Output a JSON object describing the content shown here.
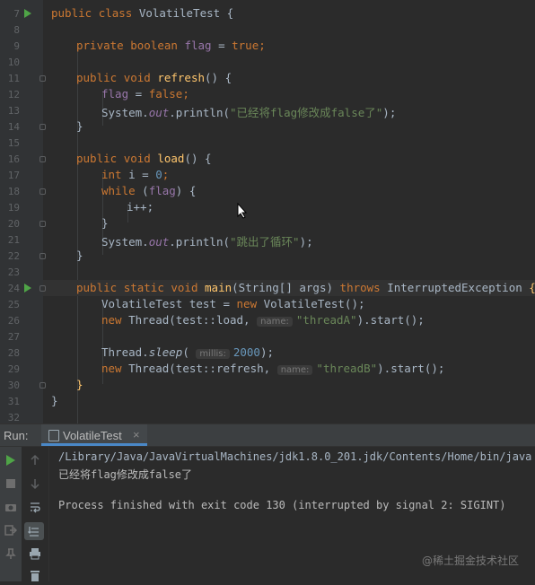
{
  "editor": {
    "lines": [
      {
        "num": "7",
        "tokens": [
          {
            "t": "public ",
            "c": "kw"
          },
          {
            "t": "class ",
            "c": "kw"
          },
          {
            "t": "VolatileTest {",
            "c": ""
          }
        ],
        "run": true,
        "indent": 0
      },
      {
        "num": "8",
        "tokens": [],
        "indent": 0
      },
      {
        "num": "9",
        "tokens": [
          {
            "t": "private ",
            "c": "kw"
          },
          {
            "t": "boolean ",
            "c": "kw"
          },
          {
            "t": "flag",
            "c": "fld"
          },
          {
            "t": " = ",
            "c": ""
          },
          {
            "t": "true",
            "c": "kw"
          },
          {
            "t": ";",
            "c": "kw"
          }
        ],
        "indent": 1
      },
      {
        "num": "10",
        "tokens": [],
        "indent": 0
      },
      {
        "num": "11",
        "tokens": [
          {
            "t": "public ",
            "c": "kw"
          },
          {
            "t": "void ",
            "c": "kw"
          },
          {
            "t": "refresh",
            "c": "fn"
          },
          {
            "t": "() {",
            "c": ""
          }
        ],
        "indent": 1,
        "fold": true
      },
      {
        "num": "12",
        "tokens": [
          {
            "t": "flag",
            "c": "fld"
          },
          {
            "t": " = ",
            "c": ""
          },
          {
            "t": "false",
            "c": "kw"
          },
          {
            "t": ";",
            "c": "kw"
          }
        ],
        "indent": 2
      },
      {
        "num": "13",
        "tokens": [
          {
            "t": "System.",
            "c": ""
          },
          {
            "t": "out",
            "c": "fld ital"
          },
          {
            "t": ".println(",
            "c": ""
          },
          {
            "t": "\"已经将flag修改成false了\"",
            "c": "str"
          },
          {
            "t": ");",
            "c": ""
          }
        ],
        "indent": 2
      },
      {
        "num": "14",
        "tokens": [
          {
            "t": "}",
            "c": ""
          }
        ],
        "indent": 1,
        "fold": true
      },
      {
        "num": "15",
        "tokens": [],
        "indent": 0
      },
      {
        "num": "16",
        "tokens": [
          {
            "t": "public ",
            "c": "kw"
          },
          {
            "t": "void ",
            "c": "kw"
          },
          {
            "t": "load",
            "c": "fn"
          },
          {
            "t": "() {",
            "c": ""
          }
        ],
        "indent": 1,
        "fold": true
      },
      {
        "num": "17",
        "tokens": [
          {
            "t": "int ",
            "c": "kw"
          },
          {
            "t": "i",
            "c": ""
          },
          {
            "t": " = ",
            "c": ""
          },
          {
            "t": "0",
            "c": "num"
          },
          {
            "t": ";",
            "c": "kw"
          }
        ],
        "indent": 2
      },
      {
        "num": "18",
        "tokens": [
          {
            "t": "while ",
            "c": "kw"
          },
          {
            "t": "(",
            "c": ""
          },
          {
            "t": "flag",
            "c": "fld"
          },
          {
            "t": ") {",
            "c": ""
          }
        ],
        "indent": 2,
        "fold": true
      },
      {
        "num": "19",
        "tokens": [
          {
            "t": "i++;",
            "c": ""
          }
        ],
        "indent": 3
      },
      {
        "num": "20",
        "tokens": [
          {
            "t": "}",
            "c": ""
          }
        ],
        "indent": 2,
        "fold": true
      },
      {
        "num": "21",
        "tokens": [
          {
            "t": "System.",
            "c": ""
          },
          {
            "t": "out",
            "c": "fld ital"
          },
          {
            "t": ".println(",
            "c": ""
          },
          {
            "t": "\"跳出了循环\"",
            "c": "str"
          },
          {
            "t": ");",
            "c": ""
          }
        ],
        "indent": 2
      },
      {
        "num": "22",
        "tokens": [
          {
            "t": "}",
            "c": ""
          }
        ],
        "indent": 1,
        "fold": true
      },
      {
        "num": "23",
        "tokens": [],
        "indent": 0
      },
      {
        "num": "24",
        "tokens": [
          {
            "t": "public ",
            "c": "kw"
          },
          {
            "t": "static ",
            "c": "kw"
          },
          {
            "t": "void ",
            "c": "kw"
          },
          {
            "t": "main",
            "c": "fn"
          },
          {
            "t": "(String[] args) ",
            "c": ""
          },
          {
            "t": "throws ",
            "c": "kw"
          },
          {
            "t": "InterruptedException ",
            "c": ""
          },
          {
            "t": "{",
            "c": "fn"
          }
        ],
        "indent": 1,
        "run": true,
        "fold": true,
        "current": true
      },
      {
        "num": "25",
        "tokens": [
          {
            "t": "VolatileTest test = ",
            "c": ""
          },
          {
            "t": "new ",
            "c": "kw"
          },
          {
            "t": "VolatileTest();",
            "c": ""
          }
        ],
        "indent": 2
      },
      {
        "num": "26",
        "tokens": [
          {
            "t": "new ",
            "c": "kw"
          },
          {
            "t": "Thread(test::load, ",
            "c": ""
          },
          {
            "t": "name:",
            "c": "hint"
          },
          {
            "t": "\"threadA\"",
            "c": "str"
          },
          {
            "t": ").start();",
            "c": ""
          }
        ],
        "indent": 2
      },
      {
        "num": "27",
        "tokens": [],
        "indent": 0
      },
      {
        "num": "28",
        "tokens": [
          {
            "t": "Thread.",
            "c": ""
          },
          {
            "t": "sleep",
            "c": "ital"
          },
          {
            "t": "( ",
            "c": ""
          },
          {
            "t": "millis:",
            "c": "hint"
          },
          {
            "t": "2000",
            "c": "num"
          },
          {
            "t": ");",
            "c": ""
          }
        ],
        "indent": 2
      },
      {
        "num": "29",
        "tokens": [
          {
            "t": "new ",
            "c": "kw"
          },
          {
            "t": "Thread(test::refresh, ",
            "c": ""
          },
          {
            "t": "name:",
            "c": "hint"
          },
          {
            "t": "\"threadB\"",
            "c": "str"
          },
          {
            "t": ").start();",
            "c": ""
          }
        ],
        "indent": 2
      },
      {
        "num": "30",
        "tokens": [
          {
            "t": "}",
            "c": "fn"
          }
        ],
        "indent": 1,
        "fold": true
      },
      {
        "num": "31",
        "tokens": [
          {
            "t": "}",
            "c": ""
          }
        ],
        "indent": 0
      },
      {
        "num": "32",
        "tokens": [],
        "indent": 0
      }
    ]
  },
  "run_panel": {
    "label": "Run:",
    "tab_name": "VolatileTest",
    "tab_close": "×"
  },
  "console": {
    "line1": "/Library/Java/JavaVirtualMachines/jdk1.8.0_201.jdk/Contents/Home/bin/java ...",
    "line2": "已经将flag修改成false了",
    "line3": "Process finished with exit code 130 (interrupted by signal 2: SIGINT)"
  },
  "watermark": "@稀土掘金技术社区",
  "colors": {
    "keyword": "#cc7832",
    "method": "#ffc66d",
    "string": "#6a8759",
    "number": "#6897bb",
    "field": "#9876aa",
    "run_green": "#4fa447"
  },
  "icons": {
    "gutter_run": "play-icon",
    "toolbar": [
      "rerun-icon",
      "stop-icon",
      "camera-icon",
      "exit-icon",
      "up-arrow-icon",
      "down-arrow-icon",
      "soft-wrap-icon",
      "scroll-to-end-icon",
      "print-icon",
      "trash-icon"
    ]
  }
}
